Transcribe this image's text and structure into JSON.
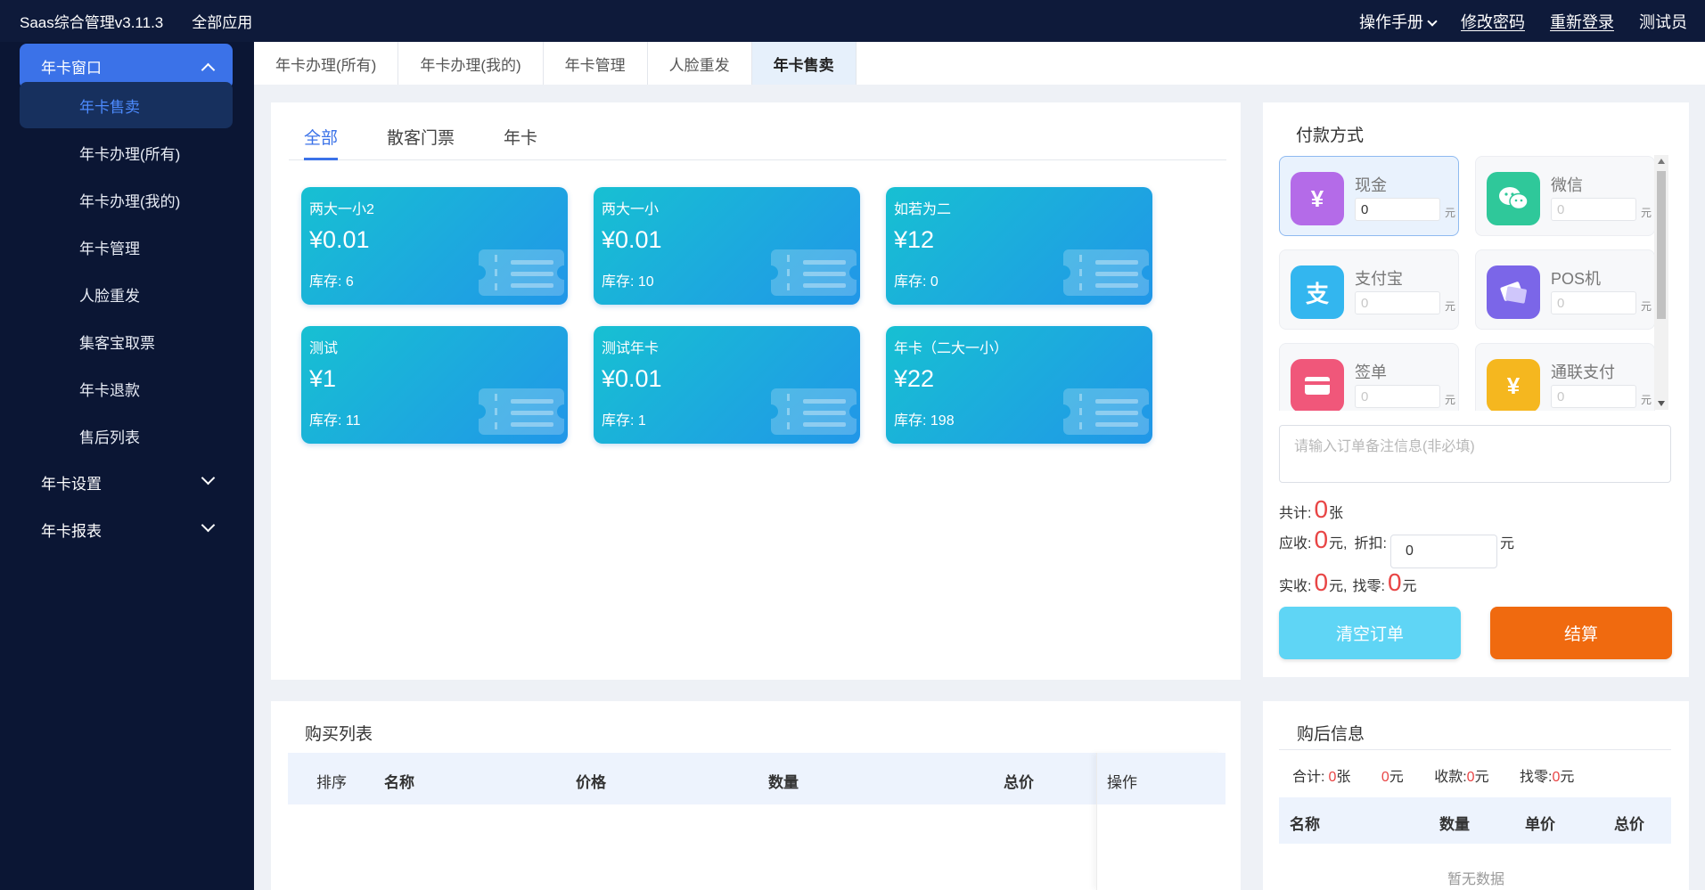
{
  "header": {
    "brand": "Saas综合管理v3.11.3",
    "all_apps": "全部应用",
    "manual": "操作手册",
    "change_password": "修改密码",
    "relogin": "重新登录",
    "user": "测试员"
  },
  "sidebar": {
    "group_main": "年卡窗口",
    "items": [
      "年卡售卖",
      "年卡办理(所有)",
      "年卡办理(我的)",
      "年卡管理",
      "人脸重发",
      "集客宝取票",
      "年卡退款",
      "售后列表"
    ],
    "group_settings": "年卡设置",
    "group_reports": "年卡报表"
  },
  "tabs": [
    "年卡办理(所有)",
    "年卡办理(我的)",
    "年卡管理",
    "人脸重发",
    "年卡售卖"
  ],
  "subtabs": [
    "全部",
    "散客门票",
    "年卡"
  ],
  "stock_label": "库存:",
  "products": [
    {
      "name": "两大一小2",
      "price": "¥0.01",
      "stock": "6"
    },
    {
      "name": "两大一小",
      "price": "¥0.01",
      "stock": "10"
    },
    {
      "name": "如若为二",
      "price": "¥12",
      "stock": "0"
    },
    {
      "name": "测试",
      "price": "¥1",
      "stock": "11"
    },
    {
      "name": "测试年卡",
      "price": "¥0.01",
      "stock": "1"
    },
    {
      "name": "年卡（二大一小）",
      "price": "¥22",
      "stock": "198"
    }
  ],
  "payment": {
    "title": "付款方式",
    "unit": "元",
    "methods": [
      {
        "label": "现金",
        "value": "0",
        "icon": "money-bag-icon",
        "color": "#b46be8"
      },
      {
        "label": "微信",
        "placeholder": "0",
        "icon": "wechat-icon",
        "color": "#2fc89a"
      },
      {
        "label": "支付宝",
        "placeholder": "0",
        "icon": "alipay-icon",
        "color": "#33b6ef"
      },
      {
        "label": "POS机",
        "placeholder": "0",
        "icon": "pos-card-icon",
        "color": "#7b66e8"
      },
      {
        "label": "签单",
        "placeholder": "0",
        "icon": "sign-bill-icon",
        "color": "#f0577a"
      },
      {
        "label": "通联支付",
        "placeholder": "0",
        "icon": "yen-icon",
        "color": "#f5b71f"
      }
    ],
    "remark_placeholder": "请输入订单备注信息(非必填)"
  },
  "summary": {
    "total_label": "共计:",
    "total_count": "0",
    "total_unit": "张",
    "receivable_label": "应收:",
    "receivable": "0",
    "yuan_comma": "元,",
    "discount_label": "折扣:",
    "discount_value": "0",
    "yuan": "元",
    "actual_label": "实收:",
    "actual": "0",
    "change_label": "找零:",
    "change": "0"
  },
  "buttons": {
    "clear": "清空订单",
    "settle": "结算"
  },
  "buy_list": {
    "title": "购买列表",
    "columns": [
      "排序",
      "名称",
      "价格",
      "数量",
      "总价",
      "操作"
    ]
  },
  "after": {
    "title": "购后信息",
    "total_label": "合计:",
    "total_count": "0",
    "zhang": "张",
    "amount": "0",
    "yuan": "元",
    "received_label": "收款:",
    "received": "0",
    "change_label": "找零:",
    "change": "0",
    "columns": [
      "名称",
      "数量",
      "单价",
      "总价"
    ],
    "empty": "暂无数据"
  }
}
